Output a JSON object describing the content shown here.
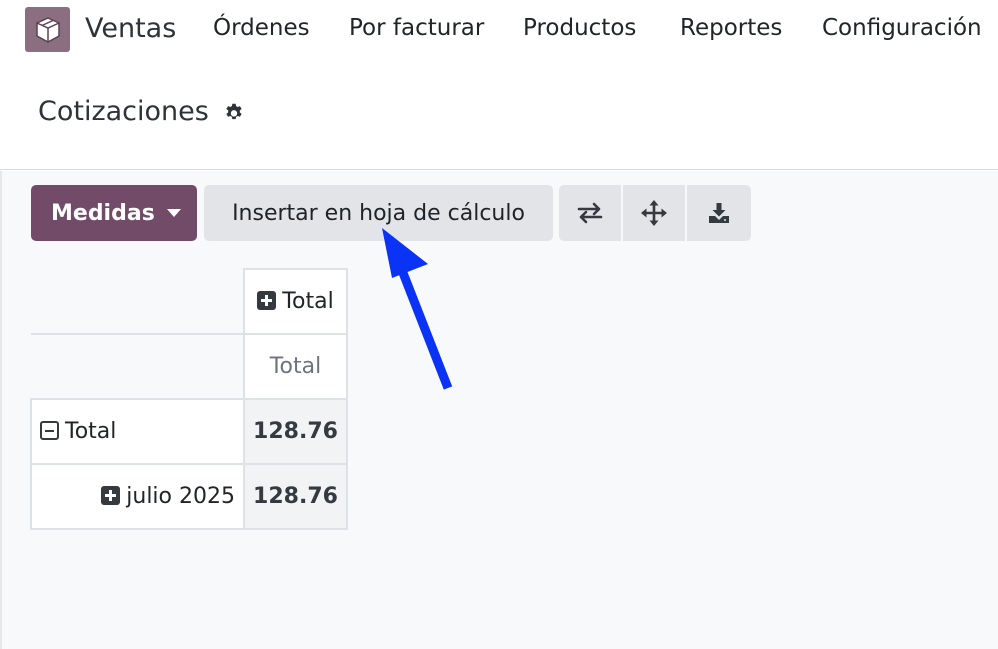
{
  "topbar": {
    "app_name": "Ventas",
    "menu": [
      "Órdenes",
      "Por facturar",
      "Productos",
      "Reportes",
      "Configuración"
    ]
  },
  "breadcrumb": {
    "title": "Cotizaciones"
  },
  "toolbar": {
    "measures_label": "Medidas",
    "insert_label": "Insertar en hoja de cálculo",
    "icons": [
      "flip-axis-icon",
      "expand-all-icon",
      "download-icon"
    ]
  },
  "pivot": {
    "col_header": "Total",
    "col_measure": "Total",
    "rows": [
      {
        "label": "Total",
        "value": "128.76",
        "state": "expanded"
      },
      {
        "label": "julio 2025",
        "value": "128.76",
        "state": "collapsed"
      }
    ]
  },
  "colors": {
    "brand": "#714b67",
    "annotation_arrow": "#0a33f5"
  }
}
